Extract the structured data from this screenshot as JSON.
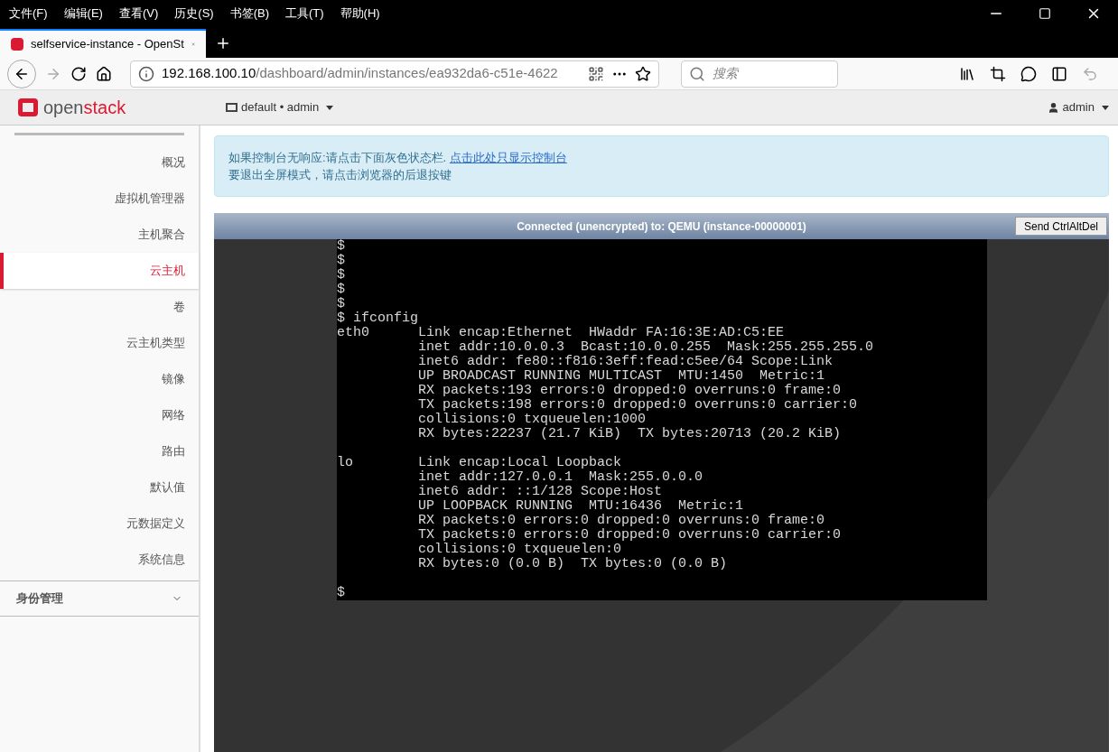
{
  "menu_bar": [
    "文件(F)",
    "编辑(E)",
    "查看(V)",
    "历史(S)",
    "书签(B)",
    "工具(T)",
    "帮助(H)"
  ],
  "tabs": [
    {
      "title": "selfservice-instance - OpenSt",
      "selected": true
    }
  ],
  "address_bar": {
    "host": "192.168.100.10",
    "path": "/dashboard/admin/instances/ea932da6-c51e-4622"
  },
  "search": {
    "placeholder": "搜索"
  },
  "header": {
    "logo_light": "open",
    "logo_bold": "stack",
    "project": "default • admin",
    "user": "admin"
  },
  "sidebar": {
    "items": [
      {
        "label": "概况",
        "selected": false
      },
      {
        "label": "虚拟机管理器",
        "selected": false
      },
      {
        "label": "主机聚合",
        "selected": false
      },
      {
        "label": "云主机",
        "selected": true
      },
      {
        "label": "卷",
        "selected": false
      },
      {
        "label": "云主机类型",
        "selected": false
      },
      {
        "label": "镜像",
        "selected": false
      },
      {
        "label": "网络",
        "selected": false
      },
      {
        "label": "路由",
        "selected": false
      },
      {
        "label": "默认值",
        "selected": false
      },
      {
        "label": "元数据定义",
        "selected": false
      },
      {
        "label": "系统信息",
        "selected": false
      }
    ],
    "section": {
      "label": "身份管理",
      "expanded": false
    }
  },
  "alert": {
    "line1": "如果控制台无响应:请点击下面灰色状态栏.",
    "link": "点击此处只显示控制台",
    "line2": "要退出全屏模式，请点击浏览器的后退按键"
  },
  "console": {
    "status": "Connected (unencrypted) to: QEMU (instance-00000001)",
    "button": "Send CtrlAltDel",
    "blocks": [
      [
        "$",
        "$",
        "$",
        "$",
        "$",
        "$ ifconfig",
        "eth0      Link encap:Ethernet  HWaddr FA:16:3E:AD:C5:EE",
        "          inet addr:10.0.0.3  Bcast:10.0.0.255  Mask:255.255.255.0",
        "          inet6 addr: fe80::f816:3eff:fead:c5ee/64 Scope:Link",
        "          UP BROADCAST RUNNING MULTICAST  MTU:1450  Metric:1",
        "          RX packets:193 errors:0 dropped:0 overruns:0 frame:0",
        "          TX packets:198 errors:0 dropped:0 overruns:0 carrier:0",
        "          collisions:0 txqueuelen:1000",
        "          RX bytes:22237 (21.7 KiB)  TX bytes:20713 (20.2 KiB)"
      ],
      [
        "lo        Link encap:Local Loopback",
        "          inet addr:127.0.0.1  Mask:255.0.0.0",
        "          inet6 addr: ::1/128 Scope:Host",
        "          UP LOOPBACK RUNNING  MTU:16436  Metric:1",
        "          RX packets:0 errors:0 dropped:0 overruns:0 frame:0",
        "          TX packets:0 errors:0 dropped:0 overruns:0 carrier:0",
        "          collisions:0 txqueuelen:0",
        "          RX bytes:0 (0.0 B)  TX bytes:0 (0.0 B)"
      ],
      [
        "$"
      ]
    ]
  }
}
